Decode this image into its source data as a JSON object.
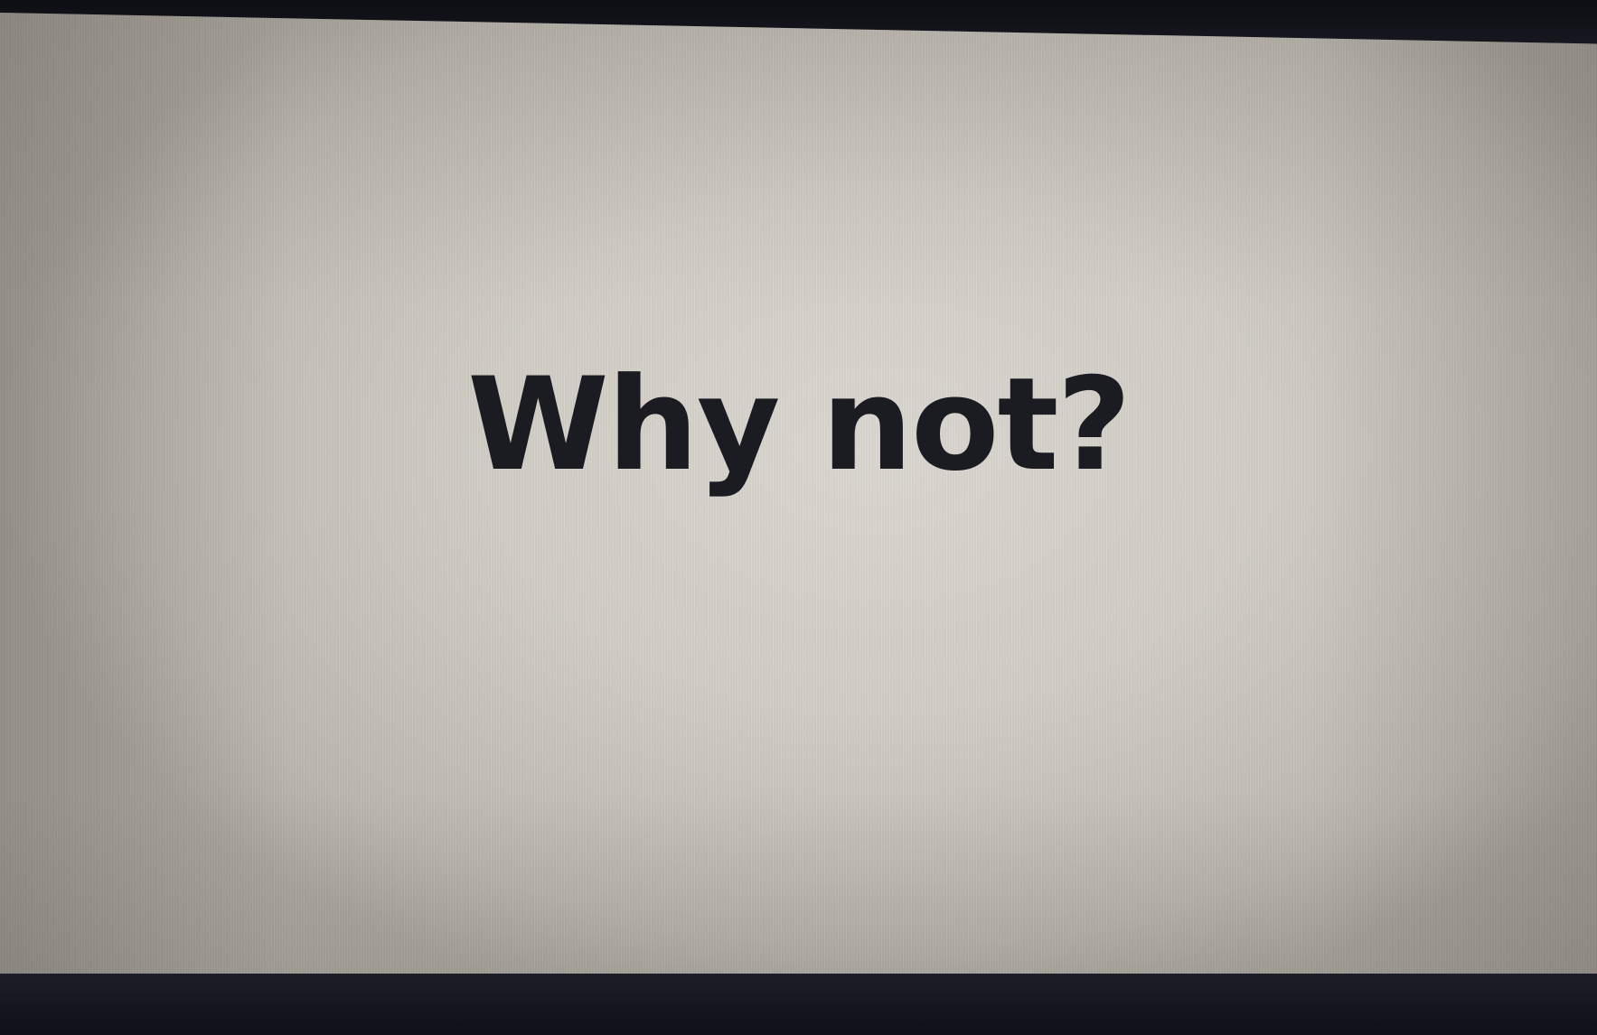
{
  "slide": {
    "title": "Why not?"
  },
  "colors": {
    "screen_background": "#d6d2cb",
    "text": "#1b1b22",
    "bezel": "#12121a"
  }
}
